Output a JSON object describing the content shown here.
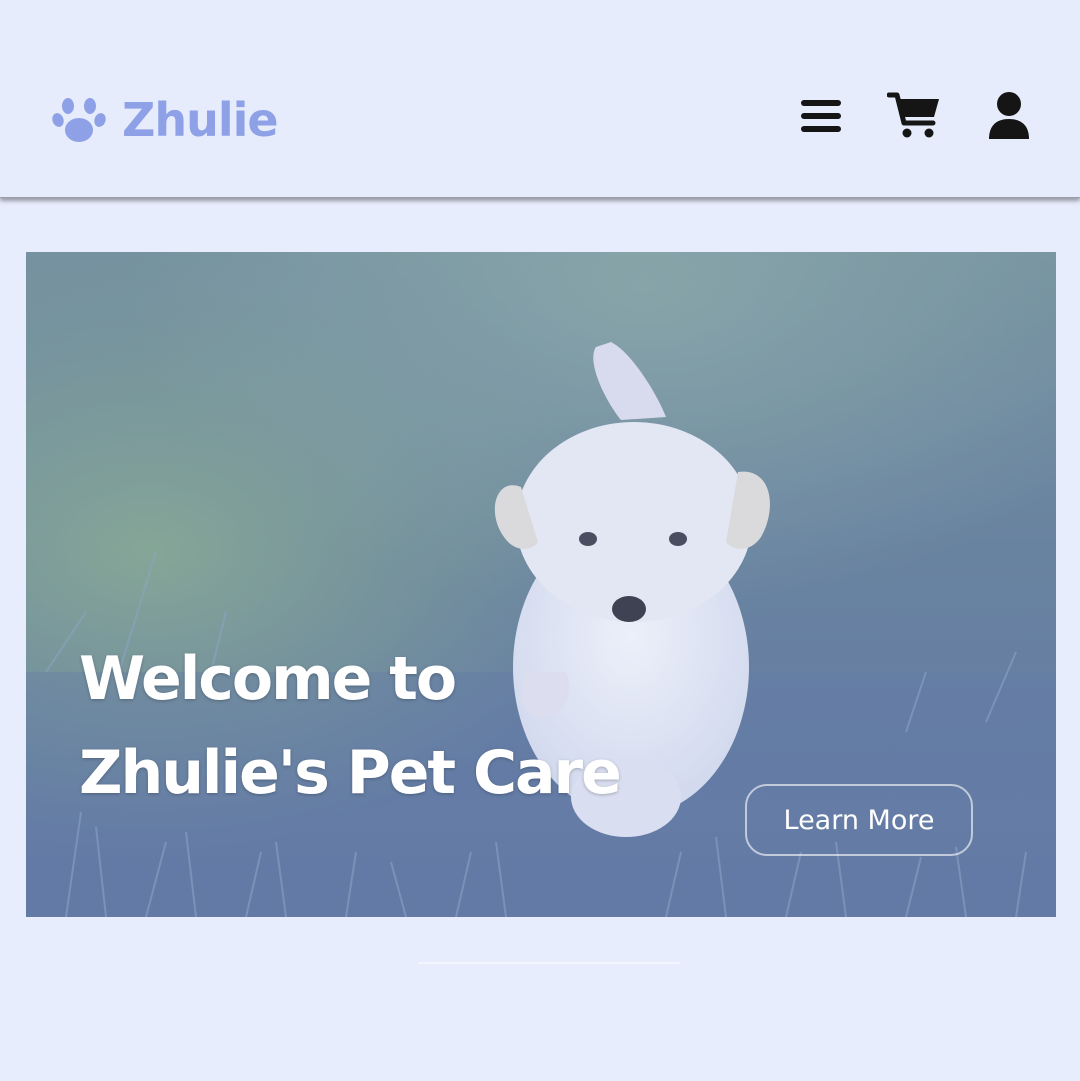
{
  "header": {
    "brand_name": "Zhulie",
    "brand_icon": "paw-icon",
    "brand_color": "#8ea1e6",
    "icons": [
      "menu-icon",
      "cart-icon",
      "user-icon"
    ]
  },
  "hero": {
    "title_line1": "Welcome to",
    "title_line2": "Zhulie's Pet Care",
    "button_label": "Learn More",
    "image": "puppy-on-grass-photo"
  }
}
